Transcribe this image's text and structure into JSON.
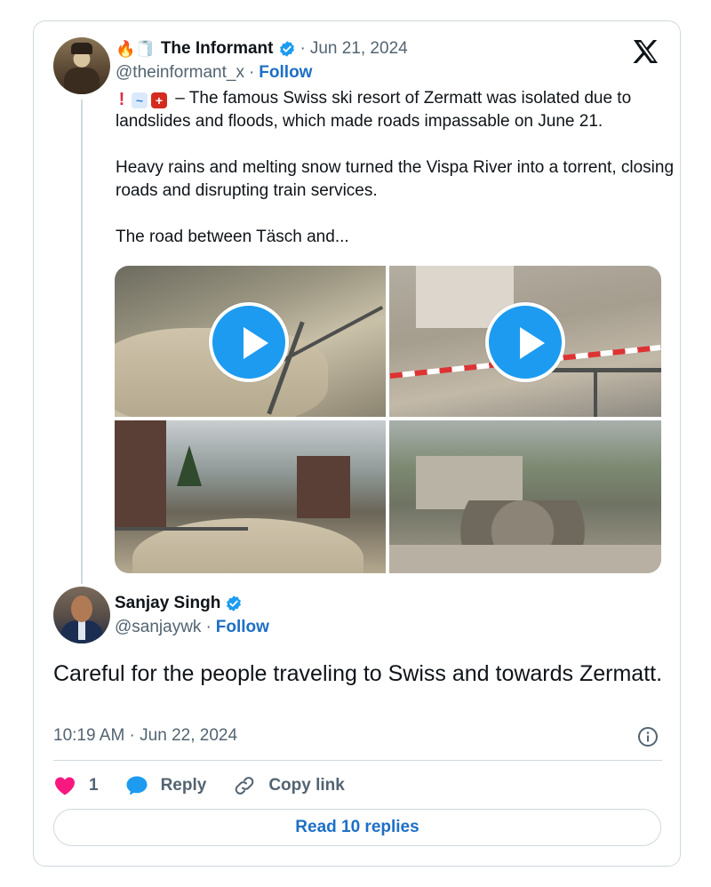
{
  "quoted_tweet": {
    "emoji_prefix": "🔥🧻",
    "author_name": "The Informant",
    "date": "Jun 21, 2024",
    "handle": "@theinformant_x",
    "follow_label": "Follow",
    "indicator_excl": "!",
    "indicator_wave": "~",
    "indicator_swiss": "+",
    "paragraphs": [
      "– The famous Swiss ski resort of Zermatt was isolated due to landslides and floods, which made roads impassable on June 21.",
      "Heavy rains and melting snow turned the Vispa River into a torrent, closing roads and disrupting train services.",
      "The road between Täsch and..."
    ],
    "media": [
      {
        "kind": "video",
        "icon": "play-icon"
      },
      {
        "kind": "video",
        "icon": "play-icon"
      },
      {
        "kind": "photo"
      },
      {
        "kind": "photo"
      }
    ]
  },
  "main_tweet": {
    "author_name": "Sanjay Singh",
    "handle": "@sanjaywk",
    "follow_label": "Follow",
    "text": "Careful for the people traveling to Swiss and towards Zermatt.",
    "timestamp": "10:19 AM · Jun 22, 2024"
  },
  "actions": {
    "like_count": "1",
    "reply_label": "Reply",
    "copy_link_label": "Copy link"
  },
  "read_replies_label": "Read 10 replies",
  "separator": "·",
  "colors": {
    "accent_blue": "#1d9bf0",
    "link_blue": "#1d6fc5",
    "like_pink": "#f91880",
    "muted": "#536471",
    "border": "#cfd9de"
  }
}
